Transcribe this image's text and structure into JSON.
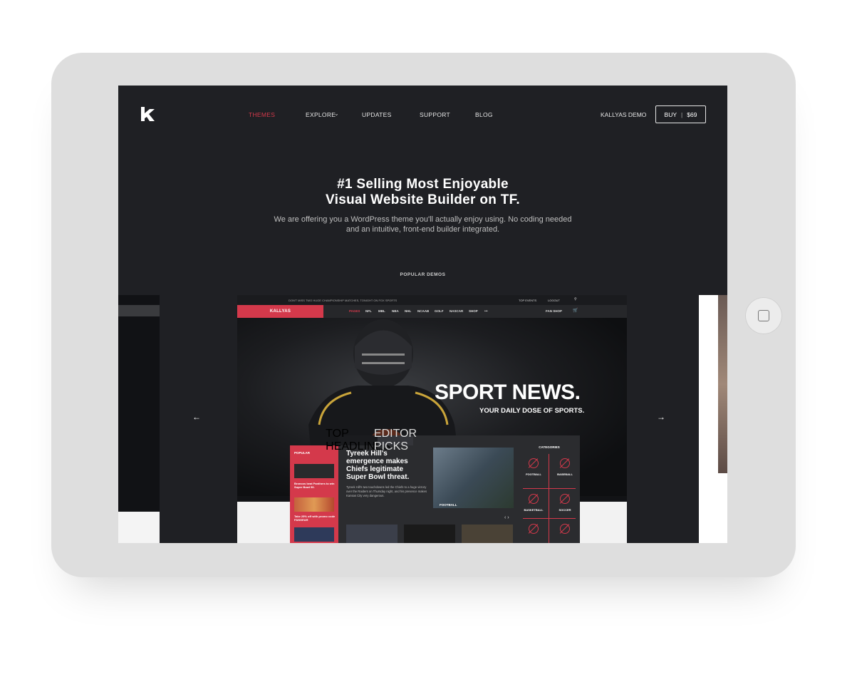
{
  "nav": {
    "items": [
      "THEMES",
      "EXPLORE",
      "UPDATES",
      "SUPPORT",
      "BLOG"
    ],
    "demo_link": "KALLYAS DEMO",
    "buy_label": "BUY",
    "buy_price": "$69"
  },
  "hero": {
    "title_line1": "#1 Selling Most Enjoyable",
    "title_line2": "Visual Website Builder on TF.",
    "subtitle_line1": "We are offering you a WordPress theme you'll actually enjoy using. No coding needed",
    "subtitle_line2": "and an intuitive, front-end builder integrated."
  },
  "popular_demos_label": "POPULAR DEMOS",
  "carousel": {
    "prev": "←",
    "next": "→"
  },
  "demo": {
    "topbar_message": "DON'T MISS TWO HUGE CHAMPIONSHIP MATCHES, TONIGHT ON FOX SPORTS",
    "top_events": "TOP EVENTS",
    "logout": "LOGOUT",
    "search_icon": "search-icon",
    "brand": "KALLYAS",
    "links": [
      "PAGES",
      "NFL",
      "MBL",
      "NBA",
      "NHL",
      "NCAAB",
      "GOLF",
      "NASCAR",
      "SHOP",
      "•••"
    ],
    "fan_shop": "FAN SHOP",
    "hero_title": "SPORT NEWS.",
    "hero_tagline": "YOUR DAILY DOSE OF SPORTS.",
    "popular_label": "POPULAR",
    "popular_items": [
      "Broncos beat Panthers to win Super Bowl 50.",
      "Take 25% off with promo code FANGEAR"
    ],
    "tabs": [
      "TOP HEADLINES",
      "EDITOR PICKS"
    ],
    "headline": "Tyreek Hill's emergence makes Chiefs legitimate Super Bowl threat.",
    "body": "Tyreek Hill's two touchdowns led the Chiefs to a huge victory over the Raiders on Thursday night, and his presence makes Kansas City very dangerous.",
    "image_tag": "FOOTBALL",
    "pager": "‹ ›",
    "categories_label": "CATEGORIES",
    "categories": [
      "FOOTBALL",
      "BASEBALL",
      "BASKETBALL",
      "SOCCER"
    ]
  },
  "colors": {
    "accent": "#d4394b",
    "screen_bg": "#1f2024",
    "bezel": "#dedede"
  }
}
